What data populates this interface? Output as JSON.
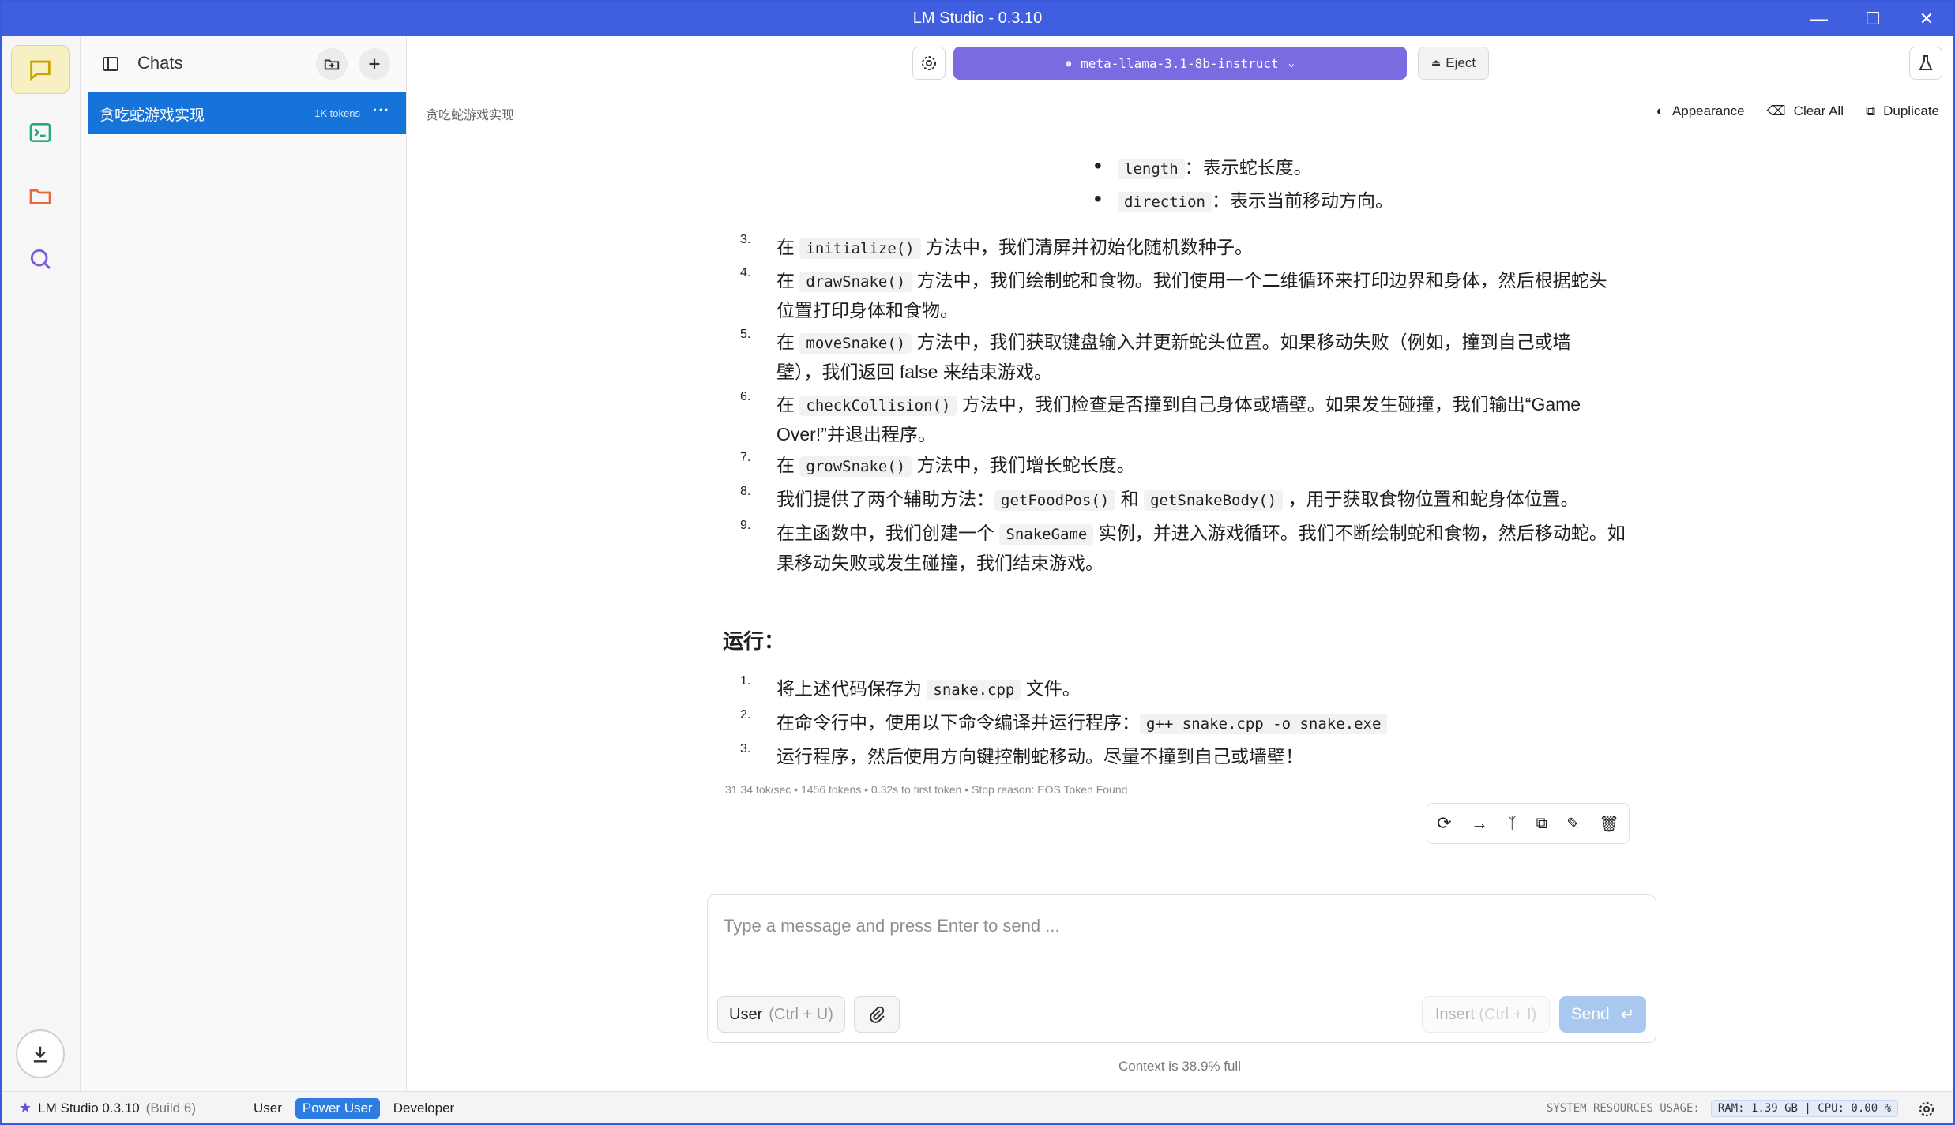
{
  "window": {
    "title": "LM Studio - 0.3.10"
  },
  "sidebar": {
    "title": "Chats",
    "chats": [
      {
        "name": "贪吃蛇游戏实现",
        "tokens": "1K tokens"
      }
    ]
  },
  "topbar": {
    "model": "meta-llama-3.1-8b-instruct",
    "eject_label": "Eject"
  },
  "subbar": {
    "breadcrumb": "贪吃蛇游戏实现",
    "appearance": "Appearance",
    "clear_all": "Clear All",
    "duplicate": "Duplicate"
  },
  "message": {
    "bullets": [
      {
        "code": "length",
        "text": "：表示蛇长度。"
      },
      {
        "code": "direction",
        "text": "：表示当前移动方向。"
      }
    ],
    "steps": [
      {
        "n": "3.",
        "pre": "在 ",
        "code": "initialize()",
        "post": " 方法中，我们清屏并初始化随机数种子。"
      },
      {
        "n": "4.",
        "pre": "在 ",
        "code": "drawSnake()",
        "post": " 方法中，我们绘制蛇和食物。我们使用一个二维循环来打印边界和身体，然后根据蛇头位置打印身体和食物。"
      },
      {
        "n": "5.",
        "pre": "在 ",
        "code": "moveSnake()",
        "post": " 方法中，我们获取键盘输入并更新蛇头位置。如果移动失败（例如，撞到自己或墙壁），我们返回 false 来结束游戏。"
      },
      {
        "n": "6.",
        "pre": "在 ",
        "code": "checkCollision()",
        "post": " 方法中，我们检查是否撞到自己身体或墙壁。如果发生碰撞，我们输出“Game Over!”并退出程序。"
      },
      {
        "n": "7.",
        "pre": "在 ",
        "code": "growSnake()",
        "post": " 方法中，我们增长蛇长度。"
      },
      {
        "n": "8.",
        "pre": "我们提供了两个辅助方法：",
        "code": "getFoodPos()",
        "mid": " 和 ",
        "code2": "getSnakeBody()",
        "post": " ，用于获取食物位置和蛇身体位置。"
      },
      {
        "n": "9.",
        "pre": "在主函数中，我们创建一个 ",
        "code": "SnakeGame",
        "post": " 实例，并进入游戏循环。我们不断绘制蛇和食物，然后移动蛇。如果移动失败或发生碰撞，我们结束游戏。"
      }
    ],
    "run_title": "运行：",
    "run_steps": [
      {
        "n": "1.",
        "pre": "将上述代码保存为 ",
        "code": "snake.cpp",
        "post": " 文件。"
      },
      {
        "n": "2.",
        "pre": "在命令行中，使用以下命令编译并运行程序：",
        "code": "g++ snake.cpp -o snake.exe",
        "post": ""
      },
      {
        "n": "3.",
        "pre": "运行程序，然后使用方向键控制蛇移动。尽量不撞到自己或墙壁！",
        "code": "",
        "post": ""
      }
    ],
    "stats": "31.34 tok/sec • 1456 tokens • 0.32s to first token • Stop reason: EOS Token Found"
  },
  "composer": {
    "placeholder": "Type a message and press Enter to send ...",
    "role": "User",
    "role_hint": "(Ctrl + U)",
    "insert": "Insert",
    "insert_hint": "(Ctrl + I)",
    "send": "Send"
  },
  "context": "Context is 38.9% full",
  "status": {
    "app": "LM Studio 0.3.10",
    "build": "(Build 6)",
    "modes": [
      "User",
      "Power User",
      "Developer"
    ],
    "active_mode": "Power User",
    "resources_label": "SYSTEM RESOURCES USAGE:",
    "ram": "RAM: 1.39 GB",
    "cpu": "CPU: 0.00 %"
  },
  "colors": {
    "titlebar": "#3f5fe0",
    "accent": "#1673d9",
    "model": "#7b6be0"
  }
}
